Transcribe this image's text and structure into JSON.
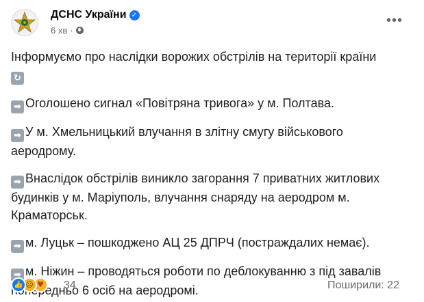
{
  "post": {
    "page_name": "ДСНС України",
    "verified_icon": "verified-badge-icon",
    "time": "6 хв",
    "separator": "·",
    "audience_icon": "globe-icon",
    "more_label": "•••",
    "intro": "Інформуємо про наслідки ворожих обстрілів на території країни",
    "items": [
      {
        "icon": "right-arrow-icon",
        "lines": [
          "Оголошено сигнал «Повітряна тривога» у м. Полтава."
        ]
      },
      {
        "icon": "right-arrow-icon",
        "lines": [
          "У м. Хмельницький влучання в злітну смугу військового",
          "аеродрому."
        ]
      },
      {
        "icon": "right-arrow-icon",
        "lines": [
          "Внаслідок обстрілів виникло загорання 7 приватних житлових",
          "будинків у м. Маріуполь, влучання снаряду на аеродром м.",
          "Краматорськ."
        ]
      },
      {
        "icon": "right-arrow-icon",
        "lines": [
          "м. Луцьк – пошкоджено АЦ 25 ДПРЧ (постраждалих немає)."
        ]
      },
      {
        "icon": "right-arrow-icon",
        "lines": [
          "м. Ніжин – проводяться роботи по деблокуванню з під завалів",
          "попередньо 6 осіб на аеродромі."
        ]
      }
    ],
    "reactions": [
      "like-reaction-icon",
      "sad-reaction-icon",
      "care-reaction-icon"
    ],
    "reaction_count": "34",
    "shares": "Поширили: 22",
    "colors": {
      "accent": "#1877f2",
      "muted": "#65676b",
      "text": "#1c1e21"
    }
  }
}
